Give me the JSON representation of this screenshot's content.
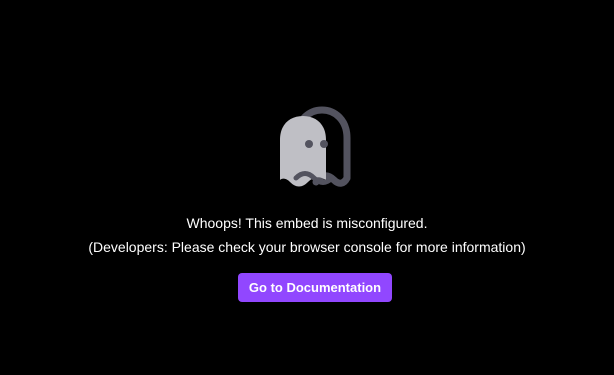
{
  "error": {
    "icon": "ghost-icon",
    "line1": "Whoops! This embed is misconfigured.",
    "line2": "(Developers: Please check your browser console for more information)"
  },
  "button": {
    "label": "Go to Documentation",
    "color": "#9147ff"
  },
  "colors": {
    "background": "#000000",
    "ghost_front": "#bfbfc5",
    "ghost_back": "#53535f"
  }
}
